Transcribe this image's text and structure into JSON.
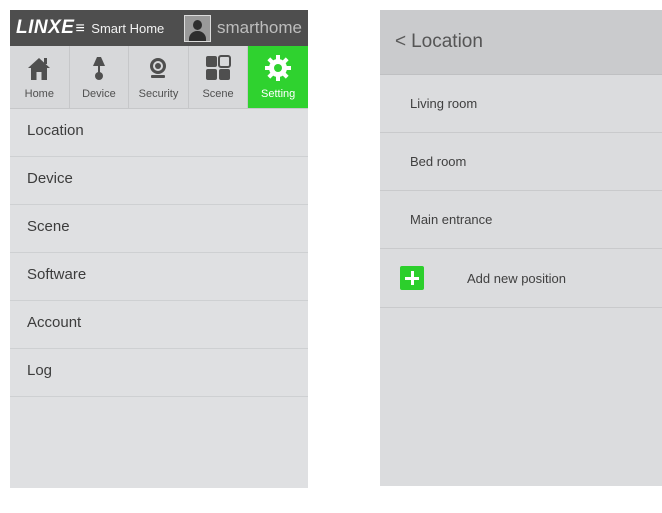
{
  "app": {
    "logo_text": "LINXE",
    "logo_bars": "≡",
    "subtitle": "Smart Home",
    "username": "smarthome"
  },
  "nav": [
    {
      "label": "Home",
      "icon": "home-icon"
    },
    {
      "label": "Device",
      "icon": "lamp-icon"
    },
    {
      "label": "Security",
      "icon": "camera-icon"
    },
    {
      "label": "Scene",
      "icon": "grid-icon"
    },
    {
      "label": "Setting",
      "icon": "gear-icon",
      "active": true
    }
  ],
  "settings_menu": [
    {
      "label": "Location"
    },
    {
      "label": "Device"
    },
    {
      "label": "Scene"
    },
    {
      "label": "Software"
    },
    {
      "label": "Account"
    },
    {
      "label": "Log"
    }
  ],
  "location": {
    "back_label": "<",
    "title": "Location",
    "items": [
      {
        "label": "Living room"
      },
      {
        "label": "Bed room"
      },
      {
        "label": "Main entrance"
      }
    ],
    "add_label": "Add new position"
  },
  "colors": {
    "accent": "#2fd22f",
    "topbar": "#4e4e4e",
    "panel": "#dfe0e2"
  }
}
